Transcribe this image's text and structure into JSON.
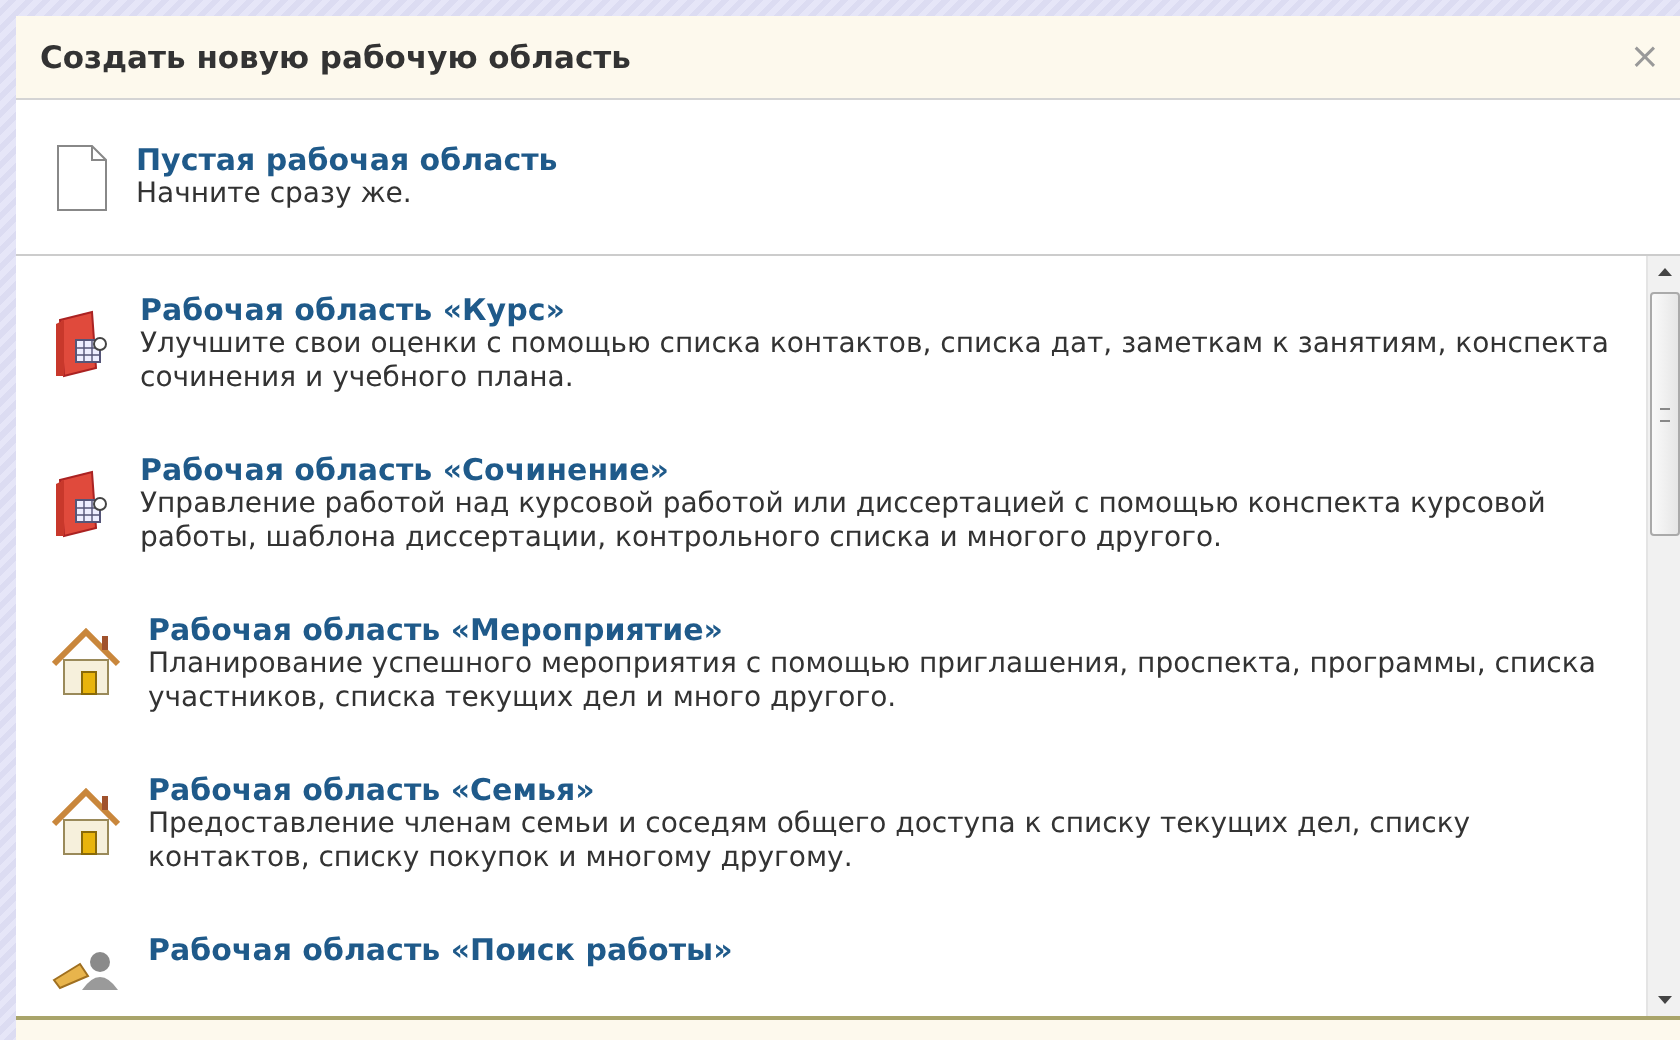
{
  "dialog": {
    "title": "Создать новую рабочую область",
    "close": "×"
  },
  "blank": {
    "title": "Пустая рабочая область",
    "description": "Начните сразу же."
  },
  "templates": [
    {
      "kind": "book",
      "title": "Рабочая область «Курс»",
      "description": "Улучшите свои оценки с помощью списка контактов, списка дат, заметкам к занятиям, конспекта сочинения и учебного плана."
    },
    {
      "kind": "book",
      "title": "Рабочая область «Сочинение»",
      "description": "Управление работой над курсовой работой или диссертацией с помощью конспекта курсовой работы, шаблона диссертации, контрольного списка и многого другого."
    },
    {
      "kind": "house",
      "title": "Рабочая область «Мероприятие»",
      "description": "Планирование успешного мероприятия с помощью приглашения, проспекта, программы, списка участников, списка текущих дел и много другого."
    },
    {
      "kind": "house",
      "title": "Рабочая область «Семья»",
      "description": "Предоставление членам семьи и соседям общего доступа к списку текущих дел, списку контактов, списку покупок и многому другому."
    },
    {
      "kind": "person",
      "title": "Рабочая область «Поиск работы»"
    }
  ]
}
